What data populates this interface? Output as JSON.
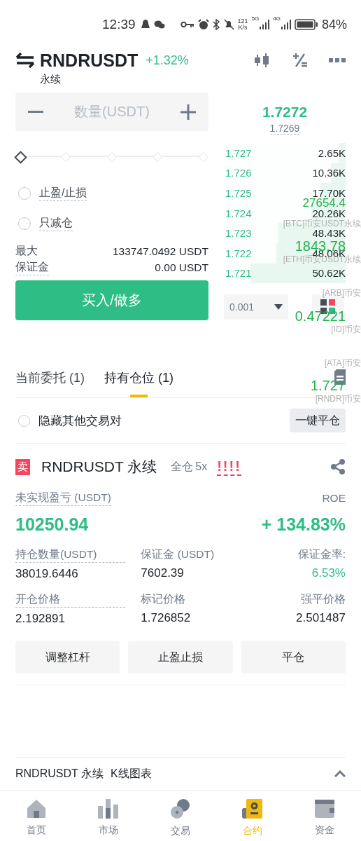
{
  "status_bar": {
    "time": "12:39",
    "net_speed": "121",
    "net_unit": "K/s",
    "signal_labels": [
      "5G",
      "4G"
    ],
    "battery": "84%"
  },
  "header": {
    "symbol": "RNDRUSDT",
    "change": "+1.32%",
    "contract": "永续"
  },
  "order_form": {
    "quantity": {
      "placeholder": "数量(USDT)"
    },
    "slider": {
      "level": 0
    },
    "options": [
      {
        "label": "止盈/止损",
        "checked": false
      },
      {
        "label": "只减仓",
        "checked": false
      }
    ],
    "summary": [
      {
        "label": "最大",
        "value": "133747.0492 USDT"
      },
      {
        "label": "保证金",
        "value": "0.00 USDT"
      }
    ],
    "submit": "买入/做多"
  },
  "order_book": {
    "last_price": "1.7272",
    "mark_price": "1.7269",
    "rows": [
      {
        "price": "1.727",
        "quantity": "2.65K",
        "level": 0.05
      },
      {
        "price": "1.726",
        "quantity": "10.36K",
        "level": 0.12
      },
      {
        "price": "1.725",
        "quantity": "17.70K",
        "level": 0.2
      },
      {
        "price": "1.724",
        "quantity": "20.26K",
        "level": 0.28
      },
      {
        "price": "1.723",
        "quantity": "48.43K",
        "level": 0.55
      },
      {
        "price": "1.722",
        "quantity": "48.06K",
        "level": 0.57
      },
      {
        "price": "1.721",
        "quantity": "50.62K",
        "level": 0.78
      }
    ],
    "precision": "0.001"
  },
  "ticker_overlay": [
    {
      "price": "27654.4",
      "label": "[BTC]币安USDT永续"
    },
    {
      "price": "1843.78",
      "label": "[ETH]币安USDT永续"
    },
    {
      "label": "[ARB]币安"
    },
    {
      "price": "0.47221",
      "label": "[ID]币安"
    },
    {
      "label": "[ATA]币安"
    },
    {
      "price": "1.727",
      "label": "[RNDR]币安"
    }
  ],
  "tabs": [
    {
      "label": "当前委托 (1)",
      "selected": false
    },
    {
      "label": "持有仓位 (1)",
      "selected": true
    }
  ],
  "hide_other_pairs": {
    "label": "隐藏其他交易对",
    "checked": false
  },
  "close_all": "一键平仓",
  "position": {
    "side": "卖",
    "symbol": "RNDRUSDT 永续",
    "margin_mode": "全仓",
    "leverage": "5x",
    "alert": "!!!!",
    "pnl_label": "未实现盈亏 (USDT)",
    "pnl": "10250.94",
    "roe_label": "ROE",
    "roe": "+ 134.83%",
    "fields": [
      {
        "label": "持仓数量(USDT)",
        "value": "38019.6446",
        "kind": "plain"
      },
      {
        "label": "保证金 (USDT)",
        "value": "7602.39",
        "kind": "plain"
      },
      {
        "label": "保证金率:",
        "value": "6.53%",
        "kind": "gain"
      },
      {
        "label": "开仓价格",
        "value": "2.192891",
        "kind": "plain"
      },
      {
        "label": "标记价格",
        "value": "1.726852",
        "kind": "plain"
      },
      {
        "label": "强平价格",
        "value": "2.501487",
        "kind": "plain"
      }
    ],
    "actions": [
      "调整杠杆",
      "止盈止损",
      "平仓"
    ]
  },
  "chart_bar": {
    "symbol": "RNDRUSDT 永续",
    "label": "K线图表"
  },
  "bottom_nav": [
    {
      "label": "首页",
      "selected": false
    },
    {
      "label": "市场",
      "selected": false
    },
    {
      "label": "交易",
      "selected": false
    },
    {
      "label": "合约",
      "selected": true
    },
    {
      "label": "资金",
      "selected": false
    }
  ]
}
